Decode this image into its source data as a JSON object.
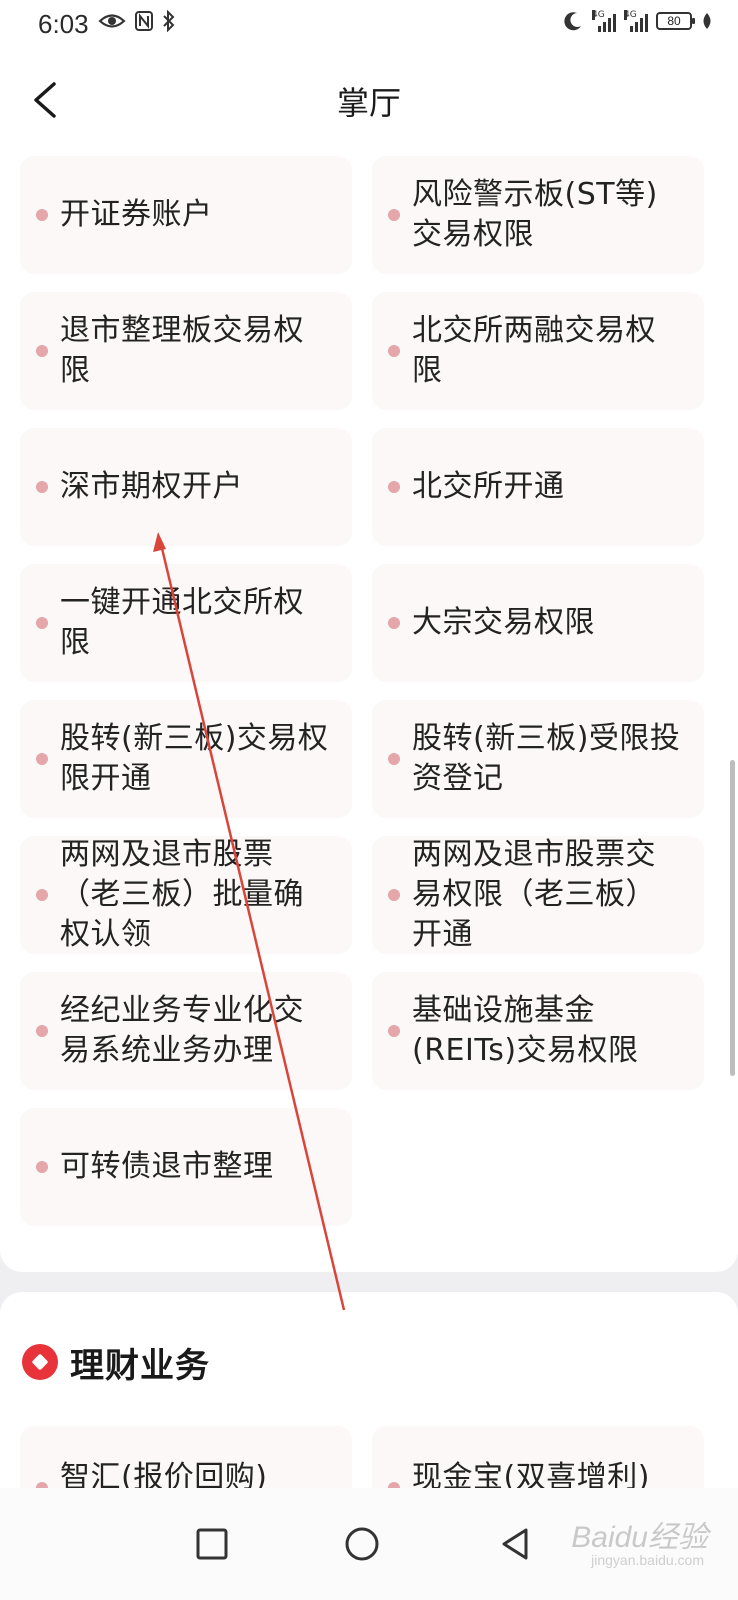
{
  "status_bar": {
    "time": "6:03",
    "battery": "80",
    "net1": "4G",
    "net2": "4G"
  },
  "header": {
    "title": "掌厅"
  },
  "cards": [
    "开证券账户",
    "风险警示板(ST等)交易权限",
    "退市整理板交易权限",
    "北交所两融交易权限",
    "深市期权开户",
    "北交所开通",
    "一键开通北交所权限",
    "大宗交易权限",
    "股转(新三板)交易权限开通",
    "股转(新三板)受限投资登记",
    "两网及退市股票（老三板）批量确权认领",
    "两网及退市股票交易权限（老三板）开通",
    "经纪业务专业化交易系统业务办理",
    "基础设施基金(REITs)交易权限",
    "可转债退市整理"
  ],
  "section2": {
    "title": "理财业务",
    "cards": [
      "智汇(报价回购)",
      "现金宝(双喜增利)"
    ]
  },
  "watermark": {
    "text": "Baidu经验",
    "sub": "jingyan.baidu.com"
  },
  "colors": {
    "accent": "#e8333a",
    "dot": "#e4a6a9",
    "card_bg": "#fcf8f7",
    "page_bg": "#efeff2",
    "arrow": "#d9453b"
  },
  "icons": [
    "eye-icon",
    "nfc-icon",
    "bluetooth-icon",
    "moon-icon",
    "signal-icon",
    "battery-icon",
    "leaf-icon",
    "back-chevron-icon",
    "square-nav-icon",
    "circle-nav-icon",
    "triangle-nav-icon",
    "diamond-icon"
  ]
}
